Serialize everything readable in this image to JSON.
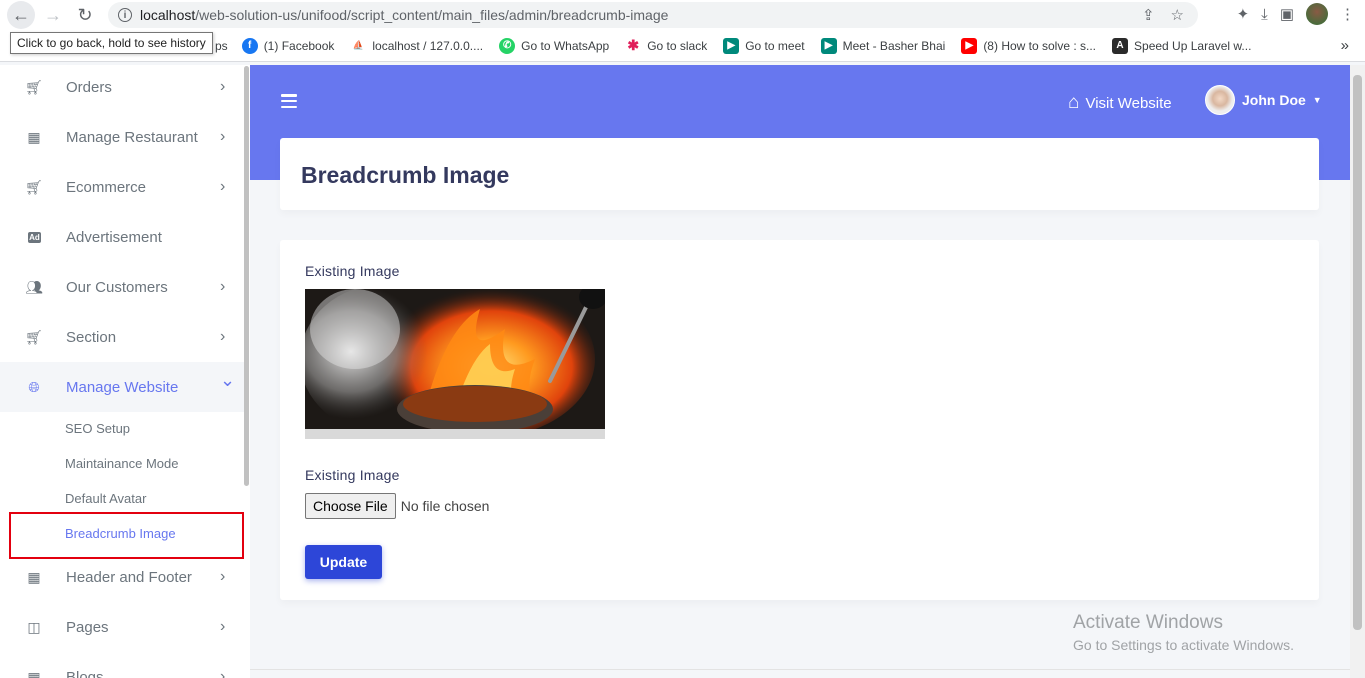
{
  "browser": {
    "url_host": "localhost",
    "url_path": "/web-solution-us/unifood/script_content/main_files/admin/breadcrumb-image",
    "tooltip": "Click to go back, hold to see history",
    "bookmarks": [
      {
        "label": "ps",
        "icon": "apps-icon"
      },
      {
        "label": "(1) Facebook",
        "icon": "facebook-icon",
        "color": "#1877f2"
      },
      {
        "label": "localhost / 127.0.0....",
        "icon": "phpmyadmin-icon",
        "color": "#f89c0e"
      },
      {
        "label": "Go to WhatsApp",
        "icon": "whatsapp-icon",
        "color": "#25d366"
      },
      {
        "label": "Go to slack",
        "icon": "slack-icon",
        "color": "#e01e5a"
      },
      {
        "label": "Go to meet",
        "icon": "meet-icon",
        "color": "#00897b"
      },
      {
        "label": "Meet - Basher Bhai",
        "icon": "meet-icon",
        "color": "#00897b"
      },
      {
        "label": "(8) How to solve : s...",
        "icon": "youtube-icon",
        "color": "#ff0000"
      },
      {
        "label": "Speed Up Laravel w...",
        "icon": "angular-icon",
        "color": "#c3002f"
      }
    ],
    "more_bookmarks": "»"
  },
  "sidebar": {
    "items": [
      {
        "label": "Orders",
        "icon": "cart-icon",
        "chevron": "›"
      },
      {
        "label": "Manage Restaurant",
        "icon": "grid-icon",
        "chevron": "›"
      },
      {
        "label": "Ecommerce",
        "icon": "cart-icon",
        "chevron": "›"
      },
      {
        "label": "Advertisement",
        "icon": "ad-icon",
        "chevron": ""
      },
      {
        "label": "Our Customers",
        "icon": "users-icon",
        "chevron": "›"
      },
      {
        "label": "Section",
        "icon": "cart-icon",
        "chevron": "›"
      },
      {
        "label": "Manage Website",
        "icon": "globe-icon",
        "chevron": "⌄"
      },
      {
        "label": "Header and Footer",
        "icon": "grid-icon",
        "chevron": "›"
      },
      {
        "label": "Pages",
        "icon": "columns-icon",
        "chevron": "›"
      },
      {
        "label": "Blogs",
        "icon": "grid-icon",
        "chevron": "›"
      }
    ],
    "sub_items": [
      "SEO Setup",
      "Maintainance Mode",
      "Default Avatar",
      "Breadcrumb Image"
    ]
  },
  "topbar": {
    "visit_label": "Visit Website",
    "user_name": "John Doe",
    "accent": "#6777ef"
  },
  "page": {
    "title": "Breadcrumb Image",
    "existing_image_label": "Existing Image",
    "upload_label": "Existing Image",
    "choose_file": "Choose File",
    "file_status": "No file chosen",
    "update_button": "Update"
  },
  "watermark": {
    "line1": "Activate Windows",
    "line2": "Go to Settings to activate Windows."
  }
}
